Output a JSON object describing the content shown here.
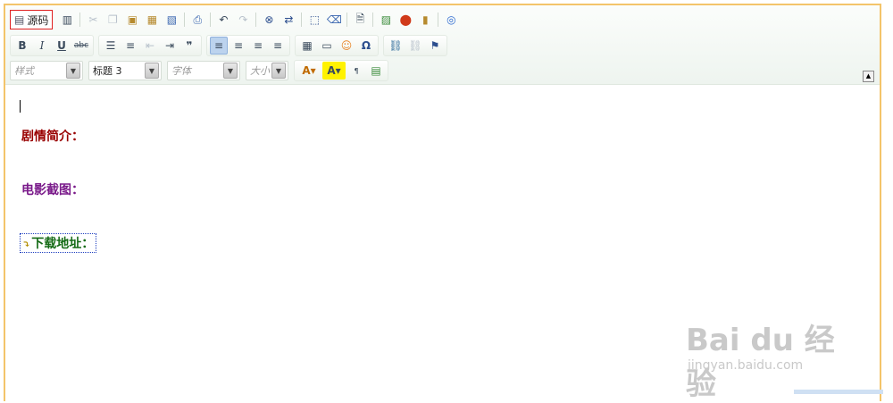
{
  "toolbar": {
    "source_label": "源码",
    "style_placeholder": "样式",
    "format_value": "标题 3",
    "font_placeholder": "字体",
    "size_placeholder": "大小"
  },
  "icons": {
    "source": "document-icon",
    "templates": "template-icon",
    "cut": "scissors-icon",
    "copy": "copy-icon",
    "paste": "paste-icon",
    "paste_text": "paste-text-icon",
    "paste_word": "paste-word-icon",
    "print": "print-icon",
    "undo": "undo-icon",
    "redo": "redo-icon",
    "find": "binoculars-icon",
    "replace": "replace-icon",
    "select_all": "select-all-icon",
    "remove_format": "eraser-icon",
    "preview": "preview-icon",
    "image": "image-icon",
    "flash": "flash-icon",
    "media": "media-icon",
    "anchor": "target-icon"
  },
  "content": {
    "heading1": "剧情简介：",
    "heading2": "电影截图：",
    "heading3": "下载地址："
  },
  "watermark": {
    "brand": "Bai du 经验",
    "url": "jingyan.baidu.com"
  },
  "colors": {
    "border": "#f3c46a",
    "heading1": "#990000",
    "heading2": "#7a1a8a",
    "heading3": "#156b16"
  }
}
